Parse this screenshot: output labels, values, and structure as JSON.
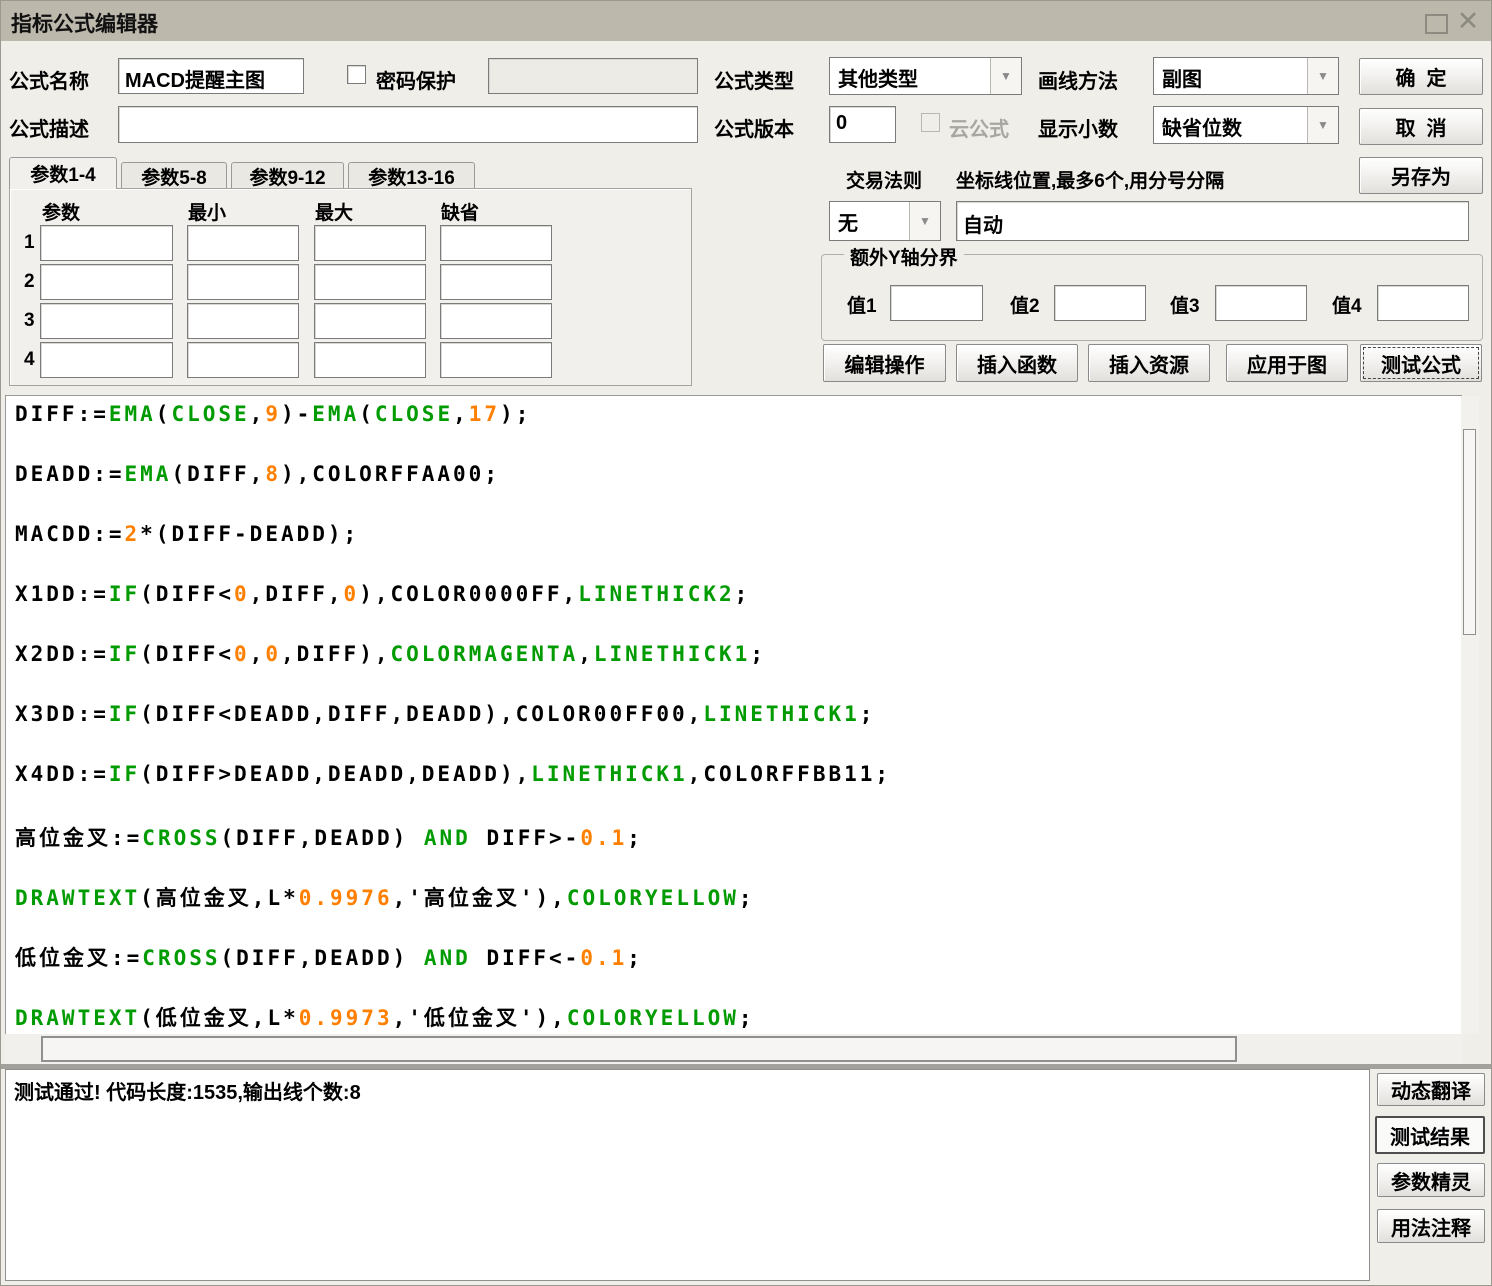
{
  "window": {
    "title": "指标公式编辑器"
  },
  "colors": {
    "titlebar": "#BDB8AC",
    "window_bg": "#F0EEE9",
    "code_green": "#009B00",
    "code_orange": "#FF8000",
    "code_default": "#000000"
  },
  "form": {
    "name_label": "公式名称",
    "name_value": "MACD提醒主图",
    "password_label": "密码保护",
    "password_checked": false,
    "password_field_value": "",
    "desc_label": "公式描述",
    "desc_value": "",
    "type_label": "公式类型",
    "type_value": "其他类型",
    "draw_label": "画线方法",
    "draw_value": "副图",
    "version_label": "公式版本",
    "version_value": "0",
    "cloud_label": "云公式",
    "cloud_checked": false,
    "decimal_label": "显示小数",
    "decimal_value": "缺省位数",
    "trade_rule_label": "交易法则",
    "coord_hint": "坐标线位置,最多6个,用分号分隔",
    "trade_rule_value": "无",
    "coord_value": "自动"
  },
  "tabs": [
    {
      "label": "参数1-4",
      "active": true
    },
    {
      "label": "参数5-8",
      "active": false
    },
    {
      "label": "参数9-12",
      "active": false
    },
    {
      "label": "参数13-16",
      "active": false
    }
  ],
  "param_table": {
    "headers": [
      "参数",
      "最小",
      "最大",
      "缺省"
    ],
    "row_numbers": [
      "1",
      "2",
      "3",
      "4"
    ],
    "cell_value": ""
  },
  "extra_y": {
    "title": "额外Y轴分界",
    "labels": [
      "值1",
      "值2",
      "值3",
      "值4"
    ],
    "values": [
      "",
      "",
      "",
      ""
    ]
  },
  "action_buttons": {
    "ok": "确  定",
    "cancel": "取  消",
    "save_as": "另存为",
    "edit_op": "编辑操作",
    "insert_func": "插入函数",
    "insert_res": "插入资源",
    "apply_chart": "应用于图",
    "test_formula": "测试公式"
  },
  "side_buttons": {
    "dynamic_translate": "动态翻译",
    "test_result": "测试结果",
    "param_wizard": "参数精灵",
    "usage_note": "用法注释"
  },
  "code": {
    "lines": [
      [
        [
          "DIFF:=",
          "d"
        ],
        [
          "EMA",
          "f"
        ],
        [
          "(",
          "d"
        ],
        [
          "CLOSE",
          "f"
        ],
        [
          ",",
          "d"
        ],
        [
          "9",
          "n"
        ],
        [
          ")-",
          "d"
        ],
        [
          "EMA",
          "f"
        ],
        [
          "(",
          "d"
        ],
        [
          "CLOSE",
          "f"
        ],
        [
          ",",
          "d"
        ],
        [
          "17",
          "n"
        ],
        [
          ");",
          "d"
        ]
      ],
      [
        [
          "DEADD:=",
          "d"
        ],
        [
          "EMA",
          "f"
        ],
        [
          "(DIFF,",
          "d"
        ],
        [
          "8",
          "n"
        ],
        [
          "),COLORFFAA00;",
          "d"
        ]
      ],
      [
        [
          "MACDD:=",
          "d"
        ],
        [
          "2",
          "n"
        ],
        [
          "*(DIFF-DEADD);",
          "d"
        ]
      ],
      [
        [
          "X1DD:=",
          "d"
        ],
        [
          "IF",
          "f"
        ],
        [
          "(DIFF<",
          "d"
        ],
        [
          "0",
          "n"
        ],
        [
          ",DIFF,",
          "d"
        ],
        [
          "0",
          "n"
        ],
        [
          "),COLOR0000FF,",
          "d"
        ],
        [
          "LINETHICK2",
          "f"
        ],
        [
          ";",
          "d"
        ]
      ],
      [
        [
          "X2DD:=",
          "d"
        ],
        [
          "IF",
          "f"
        ],
        [
          "(DIFF<",
          "d"
        ],
        [
          "0",
          "n"
        ],
        [
          ",",
          "d"
        ],
        [
          "0",
          "n"
        ],
        [
          ",DIFF),",
          "d"
        ],
        [
          "COLORMAGENTA",
          "f"
        ],
        [
          ",",
          "d"
        ],
        [
          "LINETHICK1",
          "f"
        ],
        [
          ";",
          "d"
        ]
      ],
      [
        [
          "X3DD:=",
          "d"
        ],
        [
          "IF",
          "f"
        ],
        [
          "(DIFF<DEADD,DIFF,DEADD),COLOR00FF00,",
          "d"
        ],
        [
          "LINETHICK1",
          "f"
        ],
        [
          ";",
          "d"
        ]
      ],
      [
        [
          "X4DD:=",
          "d"
        ],
        [
          "IF",
          "f"
        ],
        [
          "(DIFF>DEADD,DEADD,DEADD),",
          "d"
        ],
        [
          "LINETHICK1",
          "f"
        ],
        [
          ",COLORFFBB11;",
          "d"
        ]
      ],
      [
        [
          "高位金叉:=",
          "d"
        ],
        [
          "CROSS",
          "f"
        ],
        [
          "(DIFF,DEADD) ",
          "d"
        ],
        [
          "AND",
          "f"
        ],
        [
          " DIFF>-",
          "d"
        ],
        [
          "0.1",
          "n"
        ],
        [
          ";",
          "d"
        ]
      ],
      [
        [
          "DRAWTEXT",
          "f"
        ],
        [
          "(高位金叉,L*",
          "d"
        ],
        [
          "0.9976",
          "n"
        ],
        [
          ",'高位金叉'),",
          "d"
        ],
        [
          "COLORYELLOW",
          "f"
        ],
        [
          ";",
          "d"
        ]
      ],
      [
        [
          "低位金叉:=",
          "d"
        ],
        [
          "CROSS",
          "f"
        ],
        [
          "(DIFF,DEADD) ",
          "d"
        ],
        [
          "AND",
          "f"
        ],
        [
          " DIFF<-",
          "d"
        ],
        [
          "0.1",
          "n"
        ],
        [
          ";",
          "d"
        ]
      ],
      [
        [
          "DRAWTEXT",
          "f"
        ],
        [
          "(低位金叉,L*",
          "d"
        ],
        [
          "0.9973",
          "n"
        ],
        [
          ",'低位金叉'),",
          "d"
        ],
        [
          "COLORYELLOW",
          "f"
        ],
        [
          ";",
          "d"
        ]
      ]
    ]
  },
  "status": {
    "message": "测试通过!  代码长度:1535,输出线个数:8"
  }
}
